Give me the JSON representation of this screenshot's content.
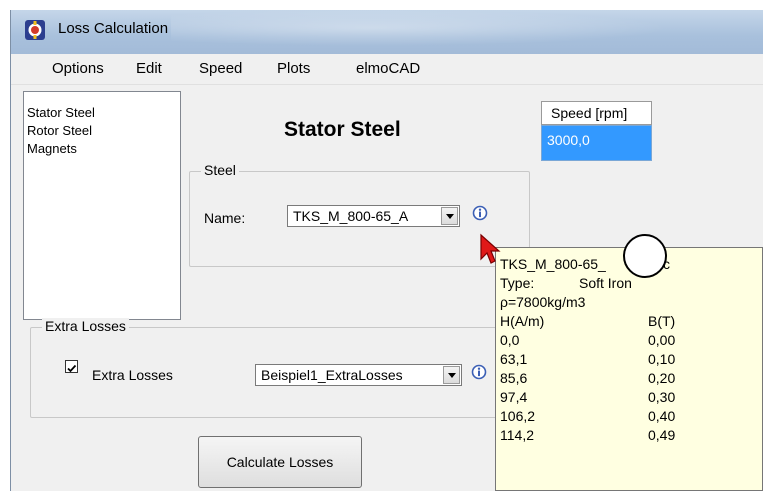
{
  "window": {
    "title": "Loss Calculation"
  },
  "menu": {
    "items": [
      "Options",
      "Edit",
      "Speed",
      "Plots",
      "elmoCAD"
    ]
  },
  "sidebar": {
    "items": [
      "Stator Steel",
      "Rotor Steel",
      "Magnets"
    ]
  },
  "main": {
    "heading": "Stator Steel",
    "steel_group": {
      "label": "Steel",
      "name_label": "Name:",
      "name_value": "TKS_M_800-65_A"
    },
    "extra_losses_group": {
      "label": "Extra Losses",
      "checkbox_label": "Extra Losses",
      "checked": true,
      "dropdown_value": "Beispiel1_ExtraLosses"
    },
    "calculate_button": "Calculate Losses"
  },
  "speed": {
    "label": "Speed [rpm]",
    "value": "3000,0"
  },
  "tooltip": {
    "name": "TKS_M_800-65_",
    "name_suffix": "c",
    "type_label": "Type:",
    "type_value": "Soft Iron",
    "density": "ρ=7800kg/m3",
    "col_h": "H(A/m)",
    "col_b": "B(T)",
    "rows": [
      {
        "h": "0,0",
        "b": "0,00"
      },
      {
        "h": "63,1",
        "b": "0,10"
      },
      {
        "h": "85,6",
        "b": "0,20"
      },
      {
        "h": "97,4",
        "b": "0,30"
      },
      {
        "h": "106,2",
        "b": "0,40"
      },
      {
        "h": "114,2",
        "b": "0,49"
      }
    ]
  },
  "icons": {
    "app": "app-icon",
    "info": "info-icon",
    "cursor": "arrow-cursor-icon"
  },
  "colors": {
    "selection": "#3399ff",
    "tooltip_bg": "#ffffe1",
    "titlebar": "#b4c8e2"
  }
}
